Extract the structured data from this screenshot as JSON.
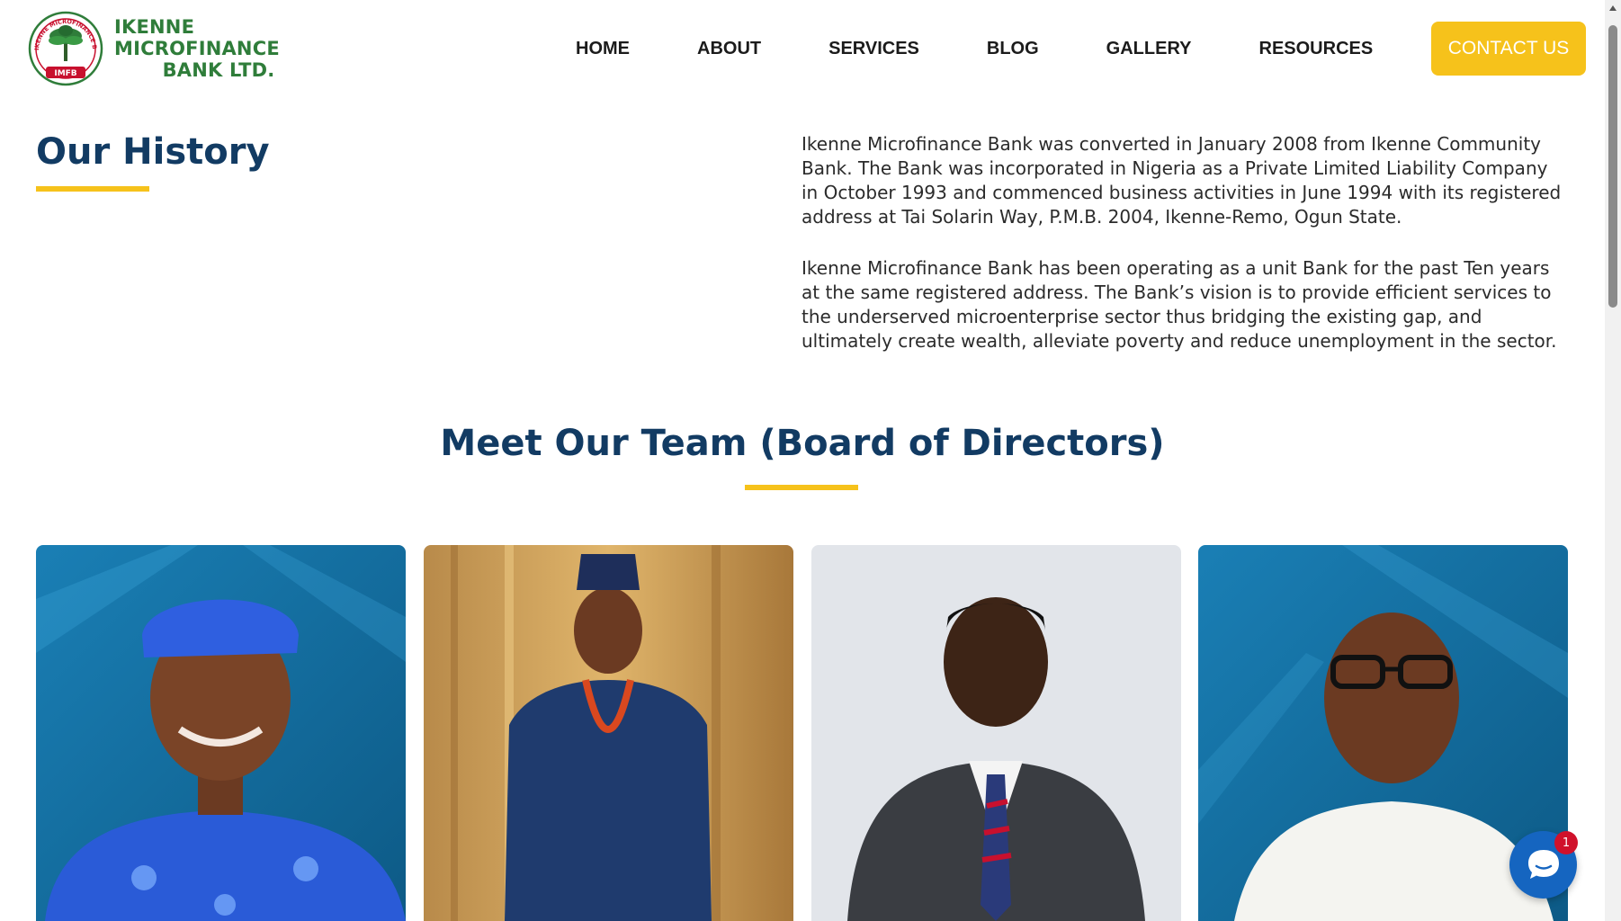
{
  "brand": {
    "name_line1": "IKENNE MICROFINANCE",
    "name_line2": "BANK LTD.",
    "seal_ring_text": "IKENNE MICROFINANCE BANK LTD",
    "seal_label": "IMFB",
    "color_green": "#2f7d3a",
    "color_red": "#c8102e"
  },
  "nav": {
    "items": [
      {
        "label": "HOME"
      },
      {
        "label": "ABOUT"
      },
      {
        "label": "SERVICES"
      },
      {
        "label": "BLOG"
      },
      {
        "label": "GALLERY"
      },
      {
        "label": "RESOURCES"
      }
    ],
    "contact_label": "CONTACT US"
  },
  "history": {
    "title": "Our History",
    "paragraphs": [
      "Ikenne Microfinance Bank was converted in January 2008 from Ikenne Community Bank. The Bank was incorporated in Nigeria as a Private Limited Liability Company in October 1993 and commenced business activities in June 1994 with its registered address at Tai Solarin Way, P.M.B. 2004, Ikenne-Remo, Ogun State.",
      "Ikenne Microfinance Bank has been operating as a unit Bank for the past Ten years at the same registered address. The Bank’s vision is to provide efficient services to the underserved microenterprise sector thus bridging the existing gap, and ultimately create wealth, alleviate poverty and reduce unemployment in the sector."
    ]
  },
  "team": {
    "title": "Meet Our Team (Board of Directors)"
  },
  "chat": {
    "badge_count": "1",
    "icon": "chat-bubble-icon"
  },
  "colors": {
    "heading": "#123b63",
    "accent": "#f6c21b",
    "chat": "#1565c0",
    "badge": "#d0112b"
  }
}
